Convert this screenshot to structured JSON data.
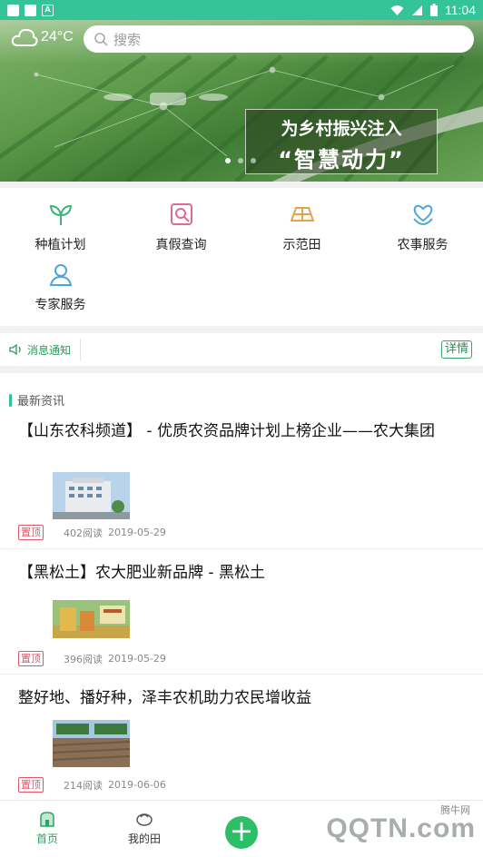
{
  "status_bar": {
    "time": "11:04"
  },
  "banner": {
    "weather": "24°C",
    "search_placeholder": "搜索",
    "slogan_line1": "为乡村振兴注入",
    "slogan_line2": "“智慧动力”"
  },
  "menu": [
    {
      "label": "种植计划",
      "icon": "sprout-icon"
    },
    {
      "label": "真假查询",
      "icon": "verify-search-icon"
    },
    {
      "label": "示范田",
      "icon": "field-icon"
    },
    {
      "label": "农事服务",
      "icon": "heart-hands-icon"
    },
    {
      "label": "专家服务",
      "icon": "expert-icon"
    }
  ],
  "notice": {
    "label": "消息通知",
    "more": "详情"
  },
  "news": {
    "section_title": "最新资讯",
    "articles": [
      {
        "title": "【山东农科频道】 - 优质农资品牌计划上榜企业——农大集团",
        "tag": "置顶",
        "reads": "402阅读",
        "date": "2019-05-29"
      },
      {
        "title": "【黑松土】农大肥业新品牌 - 黑松土",
        "tag": "置顶",
        "reads": "396阅读",
        "date": "2019-05-29"
      },
      {
        "title": "整好地、播好种，泽丰农机助力农民增收益",
        "tag": "置顶",
        "reads": "214阅读",
        "date": "2019-06-06"
      }
    ]
  },
  "bottom_nav": {
    "home": "首页",
    "my_field": "我的田",
    "watermark": "QQTN.com",
    "watermark_small": "腾牛网"
  },
  "colors": {
    "accent": "#35c398",
    "tag": "#e0556a",
    "plus": "#2bbf67"
  }
}
